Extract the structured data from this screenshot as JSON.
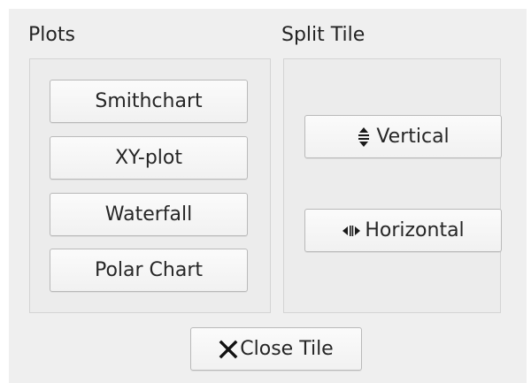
{
  "window": {
    "background": "#efefef"
  },
  "plots": {
    "title": "Plots",
    "buttons": [
      {
        "label": "Smithchart"
      },
      {
        "label": "XY-plot"
      },
      {
        "label": "Waterfall"
      },
      {
        "label": "Polar Chart"
      }
    ]
  },
  "split_tile": {
    "title": "Split Tile",
    "vertical": {
      "label": "Vertical",
      "icon": "split-vertical-icon"
    },
    "horizontal": {
      "label": "Horizontal",
      "icon": "split-horizontal-icon"
    }
  },
  "close_tile": {
    "label": "Close Tile",
    "icon": "close-icon"
  }
}
